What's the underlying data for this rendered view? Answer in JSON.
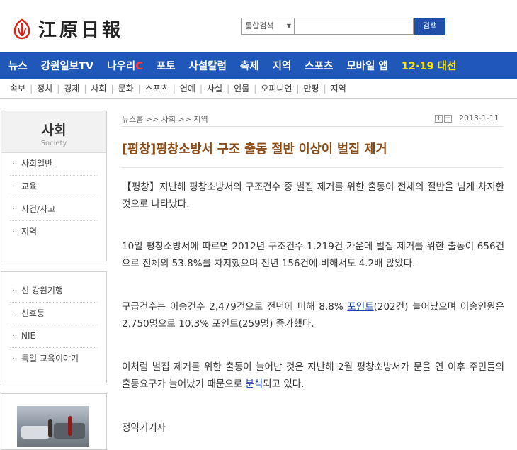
{
  "header": {
    "logo_text": "江原日報",
    "search_category": "통합검색",
    "search_placeholder": "",
    "search_button": "검색"
  },
  "main_nav": [
    {
      "label": "뉴스"
    },
    {
      "label": "강원일보TV"
    },
    {
      "label": "나우리",
      "accent": "C"
    },
    {
      "label": "포토"
    },
    {
      "label": "사설칼럼"
    },
    {
      "label": "축제"
    },
    {
      "label": "지역"
    },
    {
      "label": "스포츠"
    },
    {
      "label": "모바일 앱"
    },
    {
      "label": "12·19 대선"
    }
  ],
  "sub_nav": [
    "속보",
    "정치",
    "경제",
    "사회",
    "문화",
    "스포츠",
    "연예",
    "사설",
    "인물",
    "오피니언",
    "만평",
    "지역"
  ],
  "sidebar": {
    "title": "사회",
    "subtitle": "Society",
    "items": [
      "사회일반",
      "교육",
      "사건/사고",
      "지역"
    ],
    "extra_items": [
      "신 강원기행",
      "신호등",
      "NIE",
      "독일 교육이야기"
    ]
  },
  "article": {
    "breadcrumb": "뉴스홈 >> 사회 >> 지역",
    "date": "2013-1-11",
    "headline": "[평창]평창소방서 구조 출동 절반 이상이 벌집 제거",
    "p1": "【평창】지난해 평창소방서의 구조건수 중 벌집 제거를 위한 출동이 전체의 절반을 넘게 차지한 것으로 나타났다.",
    "p2": "10일 평창소방서에 따르면 2012년 구조건수 1,219건 가운데 벌집 제거를 위한 출동이 656건으로 전체의 53.8%를 차지했으며 전년 156건에 비해서도 4.2배 많았다.",
    "p3_a": "구급건수는 이송건수 2,479건으로 전년에 비해 8.8% ",
    "p3_link": "포인트",
    "p3_b": "(202건) 늘어났으며 이송인원은 2,750명으로 10.3% 포인트(259명) 증가했다.",
    "p4_a": "이처럼 벌집 제거를 위한 출동이 늘어난 것은 지난해 2월 평창소방서가 문을 연 이후 주민들의 출동요구가 늘어났기 때문으로 ",
    "p4_link": "분석",
    "p4_b": "되고 있다.",
    "reporter": "정익기기자"
  },
  "colors": {
    "nav_bg": "#1f58b8",
    "headline": "#8a4b16",
    "election_yellow": "#ffe200",
    "link": "#1a3fb0"
  }
}
